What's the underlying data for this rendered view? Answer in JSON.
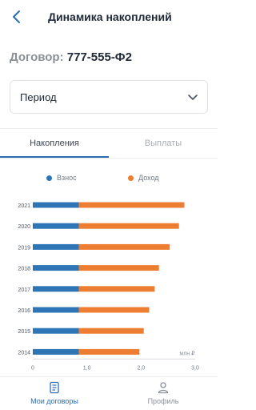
{
  "header": {
    "title": "Динамика накоплений",
    "back_icon": "chevron-left-icon"
  },
  "contract": {
    "label": "Договор:",
    "number": "777-555-Ф2"
  },
  "period": {
    "label": "Период",
    "icon": "chevron-down-icon"
  },
  "tabs": [
    {
      "label": "Накопления",
      "active": true
    },
    {
      "label": "Выплаты",
      "active": false
    }
  ],
  "colors": {
    "accent": "#2b6cb0",
    "contribution": "#2e75b6",
    "income": "#ed7d31"
  },
  "chart_data": {
    "type": "bar",
    "orientation": "horizontal",
    "stacked": true,
    "categories": [
      "2021",
      "2020",
      "2019",
      "2018",
      "2017",
      "2016",
      "2015",
      "2014"
    ],
    "series": [
      {
        "name": "Взнос",
        "color": "#2e75b6",
        "values": [
          0.85,
          0.85,
          0.85,
          0.85,
          0.85,
          0.85,
          0.85,
          0.85
        ]
      },
      {
        "name": "Доход",
        "color": "#ed7d31",
        "values": [
          1.95,
          1.85,
          1.68,
          1.48,
          1.4,
          1.3,
          1.2,
          1.12
        ]
      }
    ],
    "xlim": [
      0,
      3.0
    ],
    "xticks": [
      "0",
      "1,0",
      "2,0",
      "3,0"
    ],
    "xtick_values": [
      0,
      1.0,
      2.0,
      3.0
    ],
    "unit": "млн.₽",
    "legend_position": "top",
    "grid": false
  },
  "nav": [
    {
      "label": "Мои договоры",
      "icon": "document-icon",
      "active": true
    },
    {
      "label": "Профиль",
      "icon": "user-icon",
      "active": false
    }
  ]
}
